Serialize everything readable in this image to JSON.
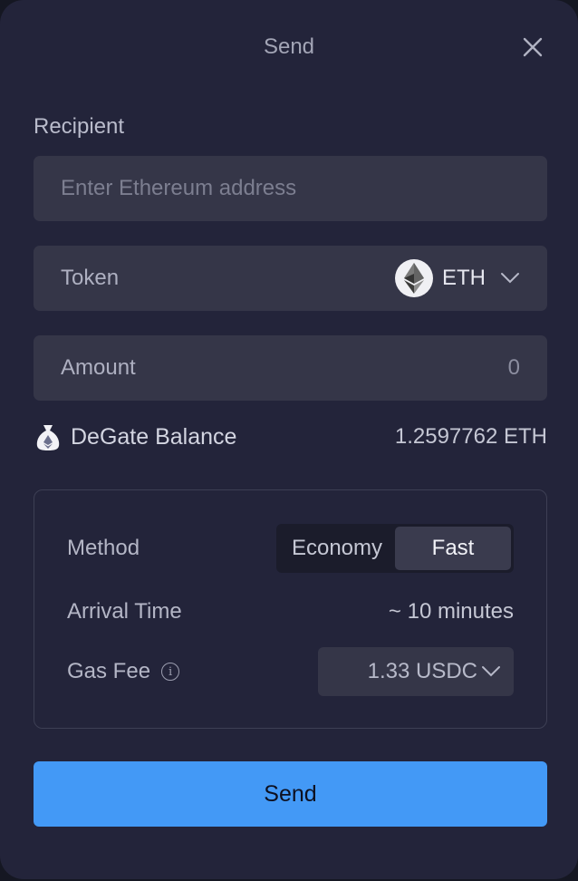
{
  "header": {
    "title": "Send",
    "close_icon": "close-icon"
  },
  "recipient": {
    "label": "Recipient",
    "placeholder": "Enter Ethereum address",
    "value": ""
  },
  "token": {
    "label": "Token",
    "symbol": "ETH",
    "icon": "ethereum-icon"
  },
  "amount": {
    "label": "Amount",
    "value": "0"
  },
  "balance": {
    "label": "DeGate Balance",
    "value": "1.2597762 ETH",
    "icon": "money-bag-icon"
  },
  "method": {
    "label": "Method",
    "options": [
      "Economy",
      "Fast"
    ],
    "selected": "Fast"
  },
  "arrival": {
    "label": "Arrival Time",
    "value": "~ 10 minutes"
  },
  "gas": {
    "label": "Gas Fee",
    "value": "1.33 USDC"
  },
  "send_button": {
    "label": "Send"
  },
  "colors": {
    "background": "#23243a",
    "field": "#353648",
    "accent": "#4399f6"
  }
}
